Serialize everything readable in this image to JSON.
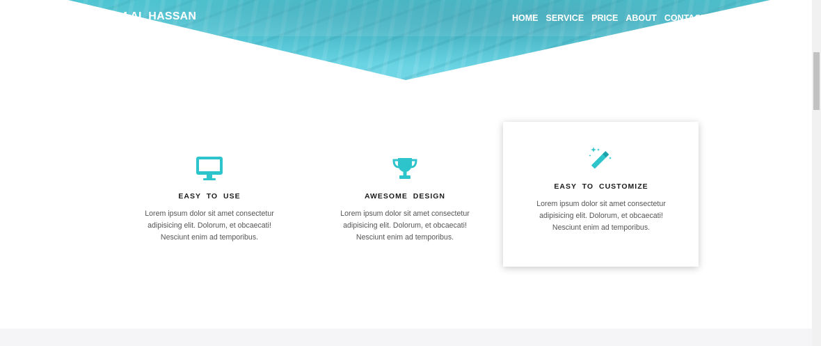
{
  "header": {
    "brand": "IM AL HASSAN",
    "nav": [
      "HOME",
      "SERVICE",
      "PRICE",
      "ABOUT",
      "CONTACT"
    ]
  },
  "features": [
    {
      "icon": "monitor-icon",
      "title": "EASY TO USE",
      "lines": [
        "Lorem ipsum dolor sit amet consectetur",
        "adipisicing elit. Dolorum, et obcaecati!",
        "Nesciunt enim ad temporibus."
      ]
    },
    {
      "icon": "trophy-icon",
      "title": "AWESOME DESIGN",
      "lines": [
        "Lorem ipsum dolor sit amet consectetur",
        "adipisicing elit. Dolorum, et obcaecati!",
        "Nesciunt enim ad temporibus."
      ]
    },
    {
      "icon": "magic-wand-icon",
      "title": "EASY TO CUSTOMIZE",
      "lines": [
        "Lorem ipsum dolor sit amet consectetur",
        "adipisicing elit. Dolorum, et obcaecati!",
        "Nesciunt enim ad temporibus."
      ]
    }
  ],
  "colors": {
    "accent": "#2ec4cc",
    "hero": "#5fd1e0"
  }
}
